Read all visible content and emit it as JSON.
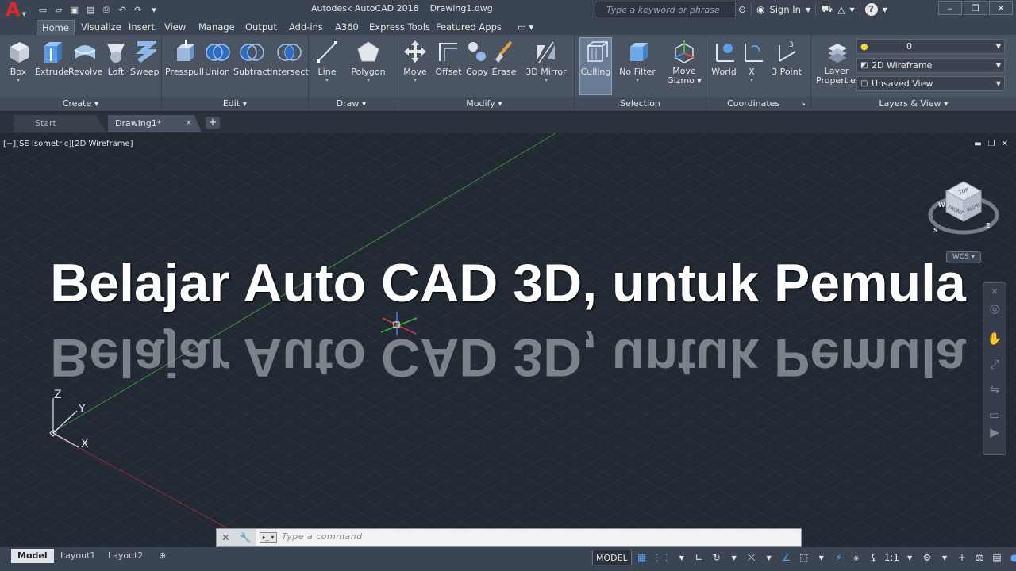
{
  "titlebar": {
    "app_name": "Autodesk AutoCAD 2018",
    "document": "Drawing1.dwg",
    "search_placeholder": "Type a keyword or phrase",
    "sign_in": "Sign In"
  },
  "ribbon_tabs": [
    "Home",
    "Visualize",
    "Insert",
    "View",
    "Manage",
    "Output",
    "Add-ins",
    "A360",
    "Express Tools",
    "Featured Apps"
  ],
  "panels": {
    "create": {
      "title": "Create",
      "tools": [
        "Box",
        "Extrude",
        "Revolve",
        "Loft",
        "Sweep"
      ]
    },
    "edit": {
      "title": "Edit",
      "tools": [
        "Presspull",
        "Union",
        "Subtract",
        "Intersect"
      ]
    },
    "draw": {
      "title": "Draw",
      "tools": [
        "Line",
        "Polygon"
      ]
    },
    "modify": {
      "title": "Modify",
      "tools": [
        "Move",
        "Offset",
        "Copy",
        "Erase",
        "3D Mirror"
      ]
    },
    "selection": {
      "title": "Selection",
      "tools": [
        "Culling",
        "No Filter",
        "Move",
        "Gizmo"
      ]
    },
    "coordinates": {
      "title": "Coordinates",
      "tools": [
        "World",
        "X",
        "3 Point"
      ]
    },
    "layers_view": {
      "title": "Layers & View",
      "layer_properties": [
        "Layer",
        "Properties"
      ],
      "layer_value": "0",
      "visual_style": "2D Wireframe",
      "named_view": "Unsaved View"
    }
  },
  "file_tabs": {
    "start": "Start",
    "drawing": "Drawing1*"
  },
  "viewport": {
    "label": "[−][SE Isometric][2D Wireframe]",
    "headline": "Belajar Auto CAD 3D, untuk Pemula",
    "wcs": "WCS",
    "ucs_axes": [
      "Z",
      "Y",
      "X"
    ],
    "viewcube_faces": [
      "TOP",
      "FRONT",
      "RIGHT"
    ],
    "compass": [
      "W",
      "S",
      "E"
    ]
  },
  "command_line": {
    "placeholder": "Type a command"
  },
  "status": {
    "layout_tabs": [
      "Model",
      "Layout1",
      "Layout2"
    ],
    "model_button": "MODEL",
    "scale": "1:1"
  },
  "colors": {
    "titlebar_bg": "#3b4452",
    "ribbon_bg": "#4a5462",
    "viewport_bg": "#222933",
    "accent_blue": "#5ca8ff",
    "logo_red": "#e02828"
  }
}
